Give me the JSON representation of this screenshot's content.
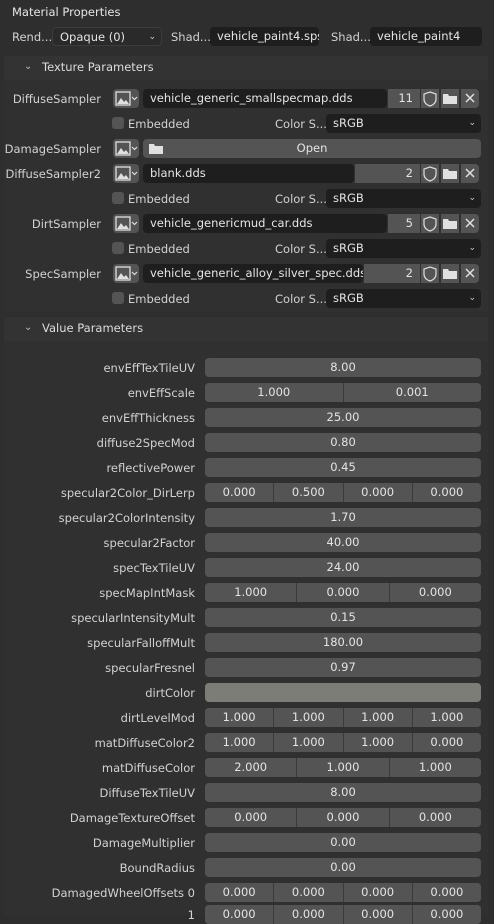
{
  "title": "Material Properties",
  "top": {
    "render_label": "Rend...",
    "render_value": "Opaque (0)",
    "shader1_label": "Shad...",
    "shader1_value": "vehicle_paint4.sps",
    "shader2_label": "Shad...",
    "shader2_value": "vehicle_paint4"
  },
  "texture_panel": {
    "title": "Texture Parameters",
    "embedded_label": "Embedded",
    "colorspace_label": "Color S...",
    "samplers": [
      {
        "label": "DiffuseSampler",
        "file": "vehicle_generic_smallspecmap.dds",
        "users": "11",
        "colorspace": "sRGB"
      },
      {
        "label": "DamageSampler",
        "open_label": "Open"
      },
      {
        "label": "DiffuseSampler2",
        "file": "blank.dds",
        "users": "2",
        "colorspace": "sRGB"
      },
      {
        "label": "DirtSampler",
        "file": "vehicle_genericmud_car.dds",
        "users": "5",
        "colorspace": "sRGB"
      },
      {
        "label": "SpecSampler",
        "file": "vehicle_generic_alloy_silver_spec.dds",
        "users": "2",
        "colorspace": "sRGB"
      }
    ]
  },
  "value_panel": {
    "title": "Value Parameters",
    "params": [
      {
        "label": "envEffTexTileUV",
        "values": [
          "8.00"
        ]
      },
      {
        "label": "envEffScale",
        "values": [
          "1.000",
          "0.001"
        ]
      },
      {
        "label": "envEffThickness",
        "values": [
          "25.00"
        ]
      },
      {
        "label": "diffuse2SpecMod",
        "values": [
          "0.80"
        ]
      },
      {
        "label": "reflectivePower",
        "values": [
          "0.45"
        ]
      },
      {
        "label": "specular2Color_DirLerp",
        "values": [
          "0.000",
          "0.500",
          "0.000",
          "0.000"
        ]
      },
      {
        "label": "specular2ColorIntensity",
        "values": [
          "1.70"
        ]
      },
      {
        "label": "specular2Factor",
        "values": [
          "40.00"
        ]
      },
      {
        "label": "specTexTileUV",
        "values": [
          "24.00"
        ]
      },
      {
        "label": "specMapIntMask",
        "values": [
          "1.000",
          "0.000",
          "0.000"
        ]
      },
      {
        "label": "specularIntensityMult",
        "values": [
          "0.15"
        ]
      },
      {
        "label": "specularFalloffMult",
        "values": [
          "180.00"
        ]
      },
      {
        "label": "specularFresnel",
        "values": [
          "0.97"
        ]
      },
      {
        "label": "dirtColor",
        "values": [],
        "color": "#7d7d78"
      },
      {
        "label": "dirtLevelMod",
        "values": [
          "1.000",
          "1.000",
          "1.000",
          "1.000"
        ]
      },
      {
        "label": "matDiffuseColor2",
        "values": [
          "1.000",
          "1.000",
          "1.000",
          "0.000"
        ]
      },
      {
        "label": "matDiffuseColor",
        "values": [
          "2.000",
          "1.000",
          "1.000"
        ]
      },
      {
        "label": "DiffuseTexTileUV",
        "values": [
          "8.00"
        ]
      },
      {
        "label": "DamageTextureOffset",
        "values": [
          "0.000",
          "0.000",
          "0.000"
        ]
      },
      {
        "label": "DamageMultiplier",
        "values": [
          "0.00"
        ]
      },
      {
        "label": "BoundRadius",
        "values": [
          "0.00"
        ]
      },
      {
        "label": "DamagedWheelOffsets 0",
        "values": [
          "0.000",
          "0.000",
          "0.000",
          "0.000"
        ]
      },
      {
        "label": "1",
        "values": [
          "0.000",
          "0.000",
          "0.000",
          "0.000"
        ]
      }
    ]
  },
  "colors": {
    "accent_field": "#545454",
    "dark_field": "#1e1e1e",
    "panel": "#303030"
  }
}
